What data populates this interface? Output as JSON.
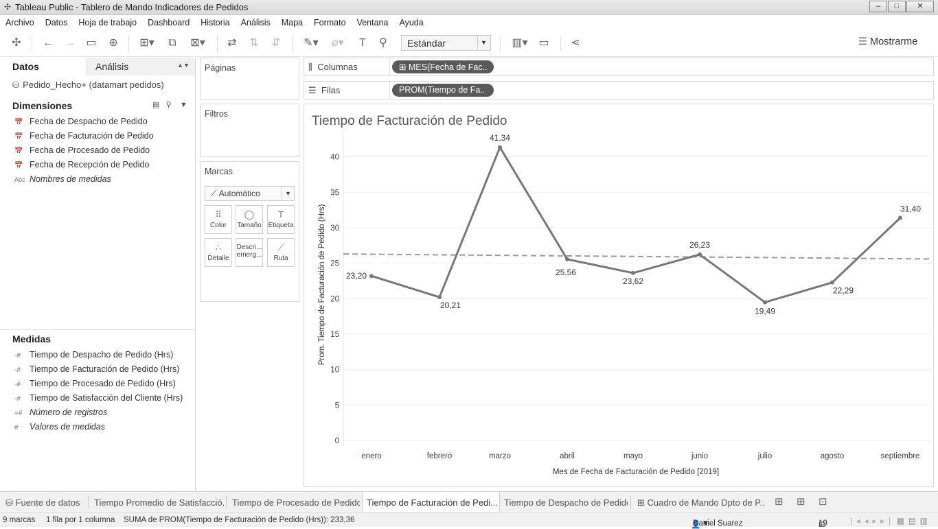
{
  "window": {
    "title": "Tableau Public - Tablero de Mando Indicadores de Pedidos",
    "minimize": "–",
    "maximize": "□",
    "close": "✕"
  },
  "menu": [
    "Archivo",
    "Datos",
    "Hoja de trabajo",
    "Dashboard",
    "Historia",
    "Análisis",
    "Mapa",
    "Formato",
    "Ventana",
    "Ayuda"
  ],
  "toolbar": {
    "fit_select": "Estándar",
    "show_me": "Mostrarme"
  },
  "data_pane": {
    "tab_data": "Datos",
    "tab_analysis": "Análisis",
    "datasource": "Pedido_Hecho+ (datamart pedidos)",
    "dimensions_header": "Dimensiones",
    "dimensions": [
      {
        "icon": "date-icon",
        "label": "Fecha de Despacho de Pedido"
      },
      {
        "icon": "date-icon",
        "label": "Fecha de Facturación de Pedido"
      },
      {
        "icon": "date-icon",
        "label": "Fecha de Procesado de Pedido"
      },
      {
        "icon": "date-icon",
        "label": "Fecha de Recepción de Pedido"
      },
      {
        "icon": "abc-icon",
        "label": "Nombres de medidas",
        "glyph": "Abc"
      }
    ],
    "measures_header": "Medidas",
    "measures": [
      {
        "label": "Tiempo de Despacho de Pedido (Hrs)"
      },
      {
        "label": "Tiempo de Facturación de Pedido (Hrs)"
      },
      {
        "label": "Tiempo de Procesado de Pedido (Hrs)"
      },
      {
        "label": "Tiempo de Satisfacción del Cliente  (Hrs)"
      },
      {
        "label": "Número de registros"
      },
      {
        "label": "Valores de medidas"
      }
    ]
  },
  "cards": {
    "pages": "Páginas",
    "filters": "Filtros",
    "marks": "Marcas",
    "mark_type": "Automático",
    "mark_buttons": [
      "Color",
      "Tamaño",
      "Etiqueta",
      "Detalle",
      "Descri... emerg...",
      "Ruta"
    ]
  },
  "shelves": {
    "columns_label": "Columnas",
    "columns_pill": "MES(Fecha de Fac..",
    "rows_label": "Filas",
    "rows_pill": "PROM(Tiempo de Fa.."
  },
  "chart_data": {
    "type": "line",
    "title": "Tiempo de Facturación de Pedido",
    "xlabel": "Mes de Fecha de Facturación de Pedido [2019]",
    "ylabel": "Prom. Tiempo de Facturación de Pedido (Hrs)",
    "categories": [
      "enero",
      "febrero",
      "marzo",
      "abril",
      "mayo",
      "junio",
      "julio",
      "agosto",
      "septiembre"
    ],
    "values": [
      23.2,
      20.21,
      41.34,
      25.56,
      23.62,
      26.23,
      19.49,
      22.29,
      31.4
    ],
    "data_labels": [
      "23,20",
      "20,21",
      "41,34",
      "25,56",
      "23,62",
      "26,23",
      "19,49",
      "22,29",
      "31,40"
    ],
    "ylim": [
      0,
      43
    ],
    "yticks": [
      0,
      5,
      10,
      15,
      20,
      25,
      30,
      35,
      40
    ],
    "trend_line": {
      "start": 26.3,
      "end": 25.6
    },
    "line_color": "#777777",
    "trend_color": "#999999",
    "grid": true
  },
  "sheet_tabs": [
    "Fuente de datos",
    "Tiempo Promedio de Satisfacció...",
    "Tiempo de Procesado de Pedido",
    "Tiempo de Facturación de Pedi...",
    "Tiempo de Despacho de Pedido",
    "Cuadro de Mando Dpto de P..."
  ],
  "status": {
    "marks": "9 marcas",
    "rows_cols": "1 fila por 1 columna",
    "sum": "SUMA de PROM(Tiempo de Facturación de Pedido (Hrs)): 233,36",
    "user": "Daniel Suarez",
    "sheet_count": "19"
  }
}
